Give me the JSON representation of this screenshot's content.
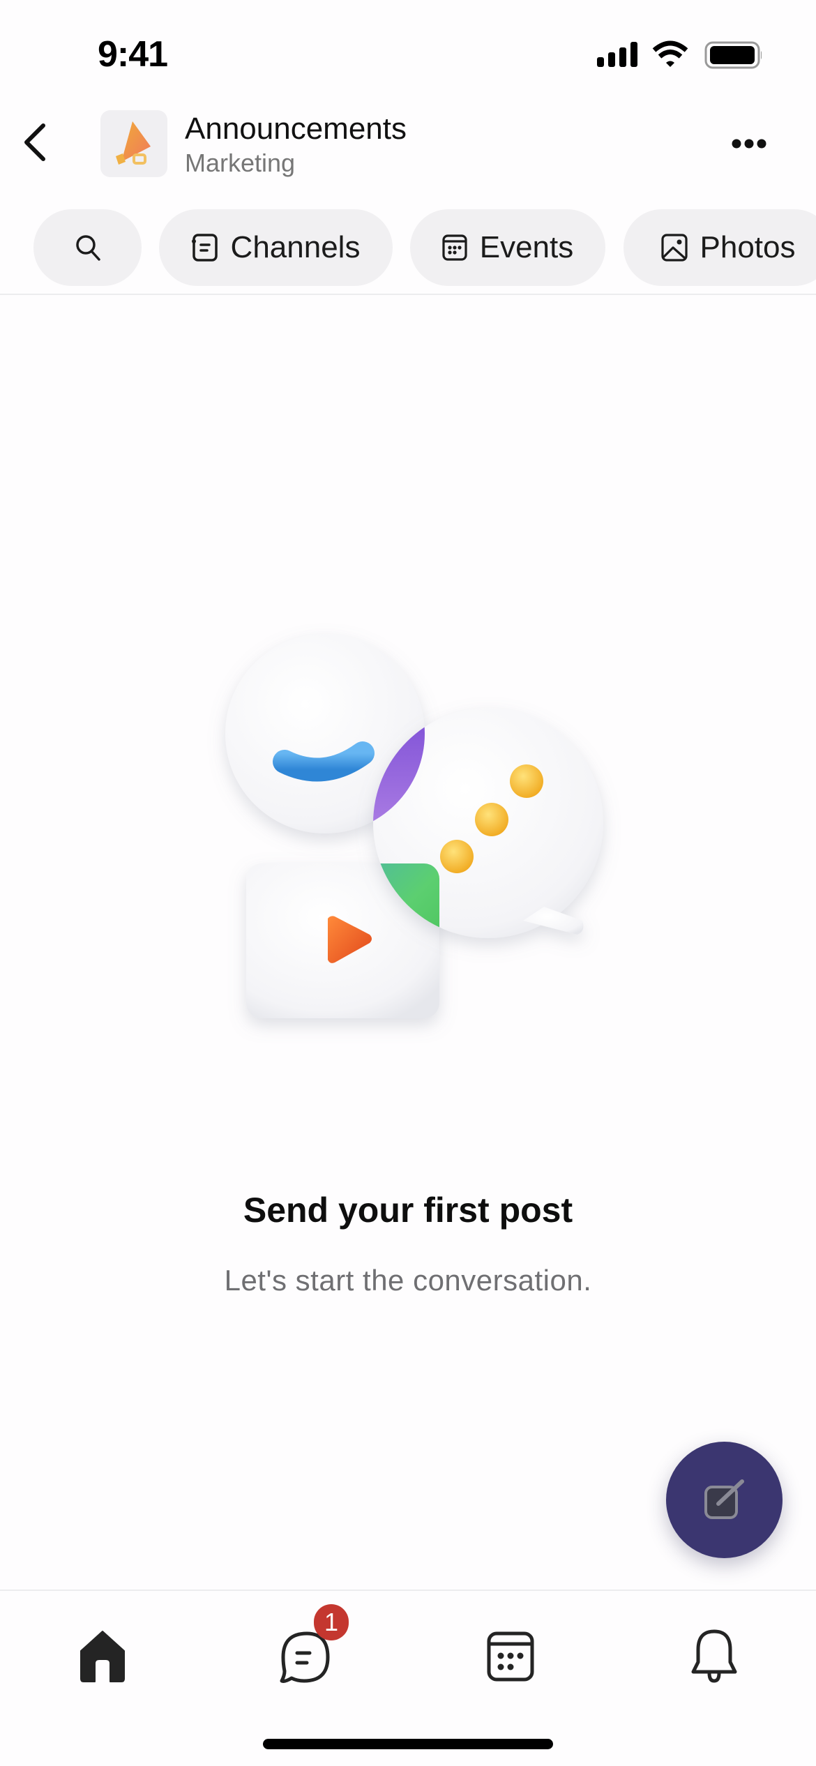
{
  "status_bar": {
    "time": "9:41",
    "icons": [
      "cellular-signal-icon",
      "wifi-icon",
      "battery-icon"
    ]
  },
  "header": {
    "back_icon": "chevron-left-icon",
    "avatar_icon": "megaphone-icon",
    "title": "Announcements",
    "subtitle": "Marketing",
    "more_icon": "more-horizontal-icon"
  },
  "pills": [
    {
      "icon": "search-icon",
      "label": ""
    },
    {
      "icon": "channels-icon",
      "label": "Channels"
    },
    {
      "icon": "calendar-icon",
      "label": "Events"
    },
    {
      "icon": "photo-icon",
      "label": "Photos"
    }
  ],
  "empty_state": {
    "illustration": "chat-bubbles-illustration",
    "title": "Send your first post",
    "subtitle": "Let's start the conversation."
  },
  "fab": {
    "icon": "compose-icon",
    "color": "#3b3670"
  },
  "tab_bar": {
    "items": [
      {
        "icon": "home-icon",
        "active": true
      },
      {
        "icon": "chat-icon",
        "badge": "1"
      },
      {
        "icon": "calendar-icon"
      },
      {
        "icon": "bell-icon"
      }
    ],
    "badge_color": "#c4372f"
  }
}
